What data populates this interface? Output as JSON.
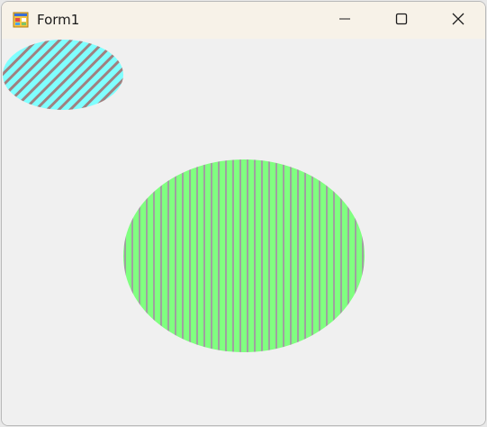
{
  "window": {
    "title": "Form1"
  },
  "titlebar": {
    "icons": {
      "app": "form-app-icon",
      "minimize": "minimize-icon",
      "maximize": "maximize-icon",
      "close": "close-icon"
    }
  },
  "canvas": {
    "shapes": [
      {
        "name": "hatched-ellipse-small",
        "shape": "ellipse",
        "fill_color": "#80ffff",
        "hatch_color": "#a08080",
        "hatch_style": "backward-diagonal"
      },
      {
        "name": "hatched-ellipse-large",
        "shape": "ellipse",
        "fill_color": "#80ff80",
        "hatch_color": "#a0a0a0",
        "hatch_style": "vertical"
      }
    ]
  }
}
